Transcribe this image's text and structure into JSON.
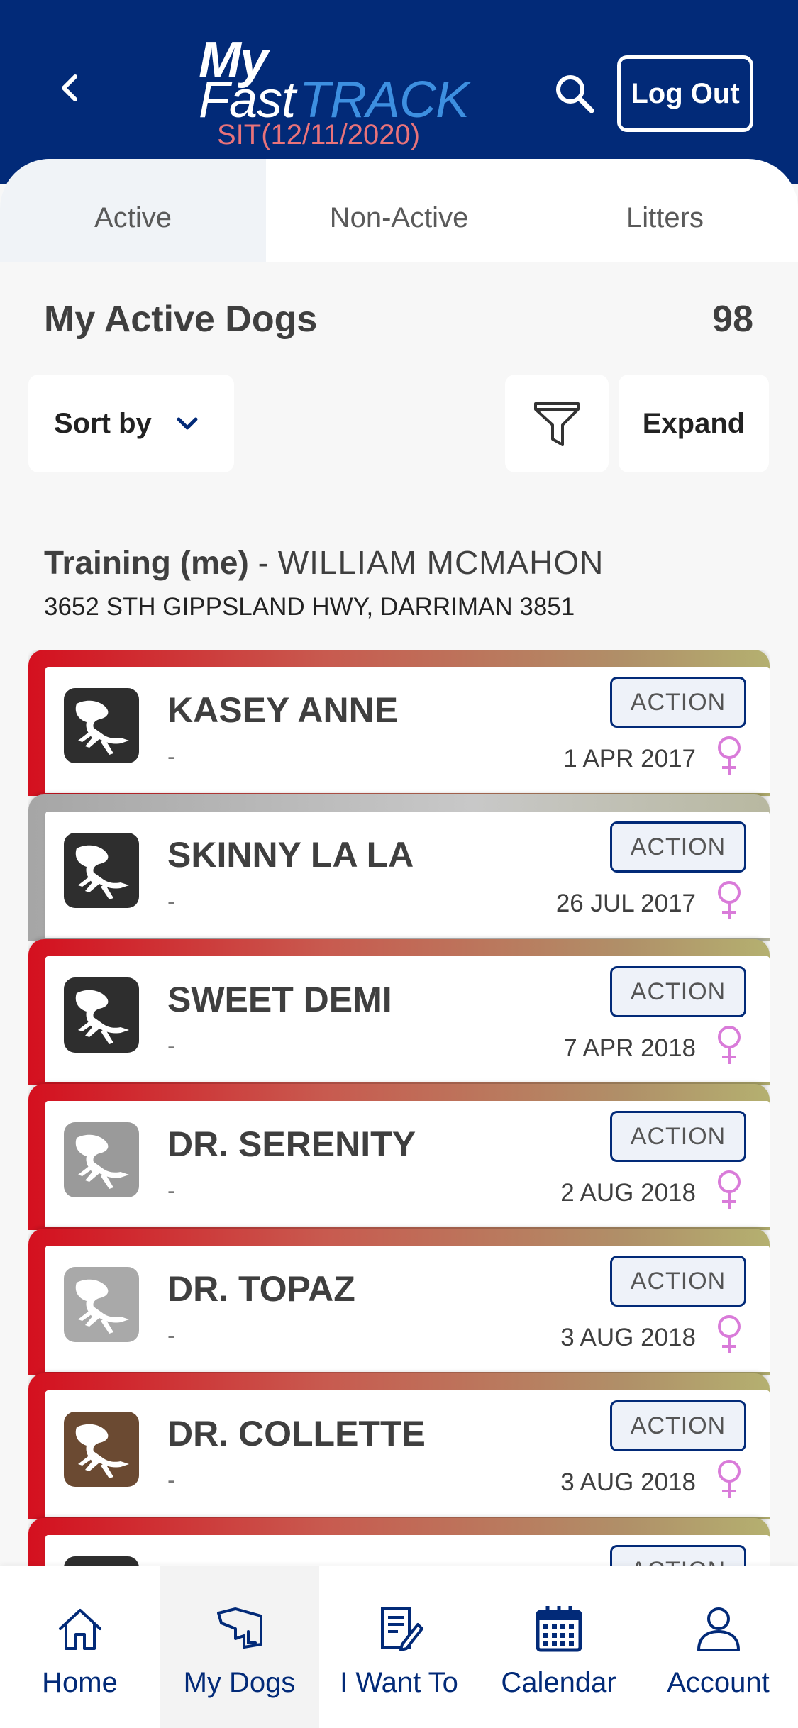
{
  "header": {
    "logo_my": "My",
    "logo_fast": "Fast",
    "logo_track": "TRACK",
    "environment": "SIT(12/11/2020)",
    "logout_label": "Log Out"
  },
  "tabs": [
    {
      "label": "Active",
      "active": true
    },
    {
      "label": "Non-Active",
      "active": false
    },
    {
      "label": "Litters",
      "active": false
    }
  ],
  "section": {
    "title": "My Active Dogs",
    "count": "98"
  },
  "toolbar": {
    "sort_label": "Sort by",
    "expand_label": "Expand"
  },
  "trainer": {
    "label": "Training (me)",
    "separator": " - ",
    "name": "WILLIAM MCMAHON",
    "address": "3652 STH GIPPSLAND HWY, DARRIMAN 3851"
  },
  "dogs": [
    {
      "name": "KASEY ANNE",
      "sub": "-",
      "date": "1 APR 2017",
      "action": "ACTION",
      "band": "red",
      "icon_color": "#2e2e2e"
    },
    {
      "name": "SKINNY LA LA",
      "sub": "-",
      "date": "26 JUL 2017",
      "action": "ACTION",
      "band": "grey",
      "icon_color": "#2e2e2e"
    },
    {
      "name": "SWEET DEMI",
      "sub": "-",
      "date": "7 APR 2018",
      "action": "ACTION",
      "band": "red",
      "icon_color": "#2e2e2e"
    },
    {
      "name": "DR. SERENITY",
      "sub": "-",
      "date": "2 AUG 2018",
      "action": "ACTION",
      "band": "red",
      "icon_color": "#9a9a9a"
    },
    {
      "name": "DR. TOPAZ",
      "sub": "-",
      "date": "3 AUG 2018",
      "action": "ACTION",
      "band": "red",
      "icon_color": "#a9a9a9"
    },
    {
      "name": "DR. COLLETTE",
      "sub": "-",
      "date": "3 AUG 2018",
      "action": "ACTION",
      "band": "red",
      "icon_color": "#6b4a32"
    },
    {
      "name": "",
      "sub": "",
      "date": "",
      "action": "ACTION",
      "band": "red",
      "icon_color": "#2e2e2e"
    }
  ],
  "bottom_nav": [
    {
      "label": "Home",
      "icon": "home-icon",
      "active": false
    },
    {
      "label": "My Dogs",
      "icon": "dogs-icon",
      "active": true
    },
    {
      "label": "I Want To",
      "icon": "form-edit-icon",
      "active": false
    },
    {
      "label": "Calendar",
      "icon": "calendar-icon",
      "active": false
    },
    {
      "label": "Account",
      "icon": "account-icon",
      "active": false
    }
  ],
  "colors": {
    "brand": "#022a78",
    "accent_blue": "#3d8fe0",
    "female": "#d97bd9",
    "band_red": "#d4101f"
  }
}
